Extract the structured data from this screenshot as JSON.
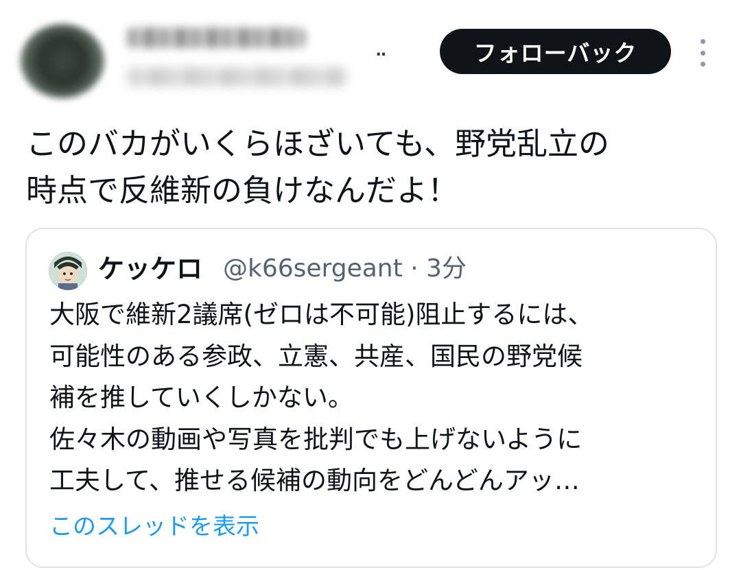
{
  "header": {
    "dots": "‥",
    "follow_back_label": "フォローバック",
    "menu_icon": "more-vertical-icon"
  },
  "tweet": {
    "text": "このバカがいくらほざいても、野党乱立の\n時点で反維新の負けなんだよ！"
  },
  "quote": {
    "author_name": "ケッケロ",
    "meta": "@k66sergeant · 3分",
    "body": "大阪で維新2議席(ゼロは不可能)阻止するには、\n可能性のある参政、立憲、共産、国民の野党候\n補を推していくしかない。\n佐々木の動画や写真を批判でも上げないように\n工夫して、推せる候補の動向をどんどんアッ…",
    "show_thread_label": "このスレッドを表示"
  },
  "colors": {
    "text": "#0f1419",
    "secondary": "#536471",
    "link": "#1d9bf0",
    "button_bg": "#0f1419",
    "border": "#dfe3e6"
  }
}
